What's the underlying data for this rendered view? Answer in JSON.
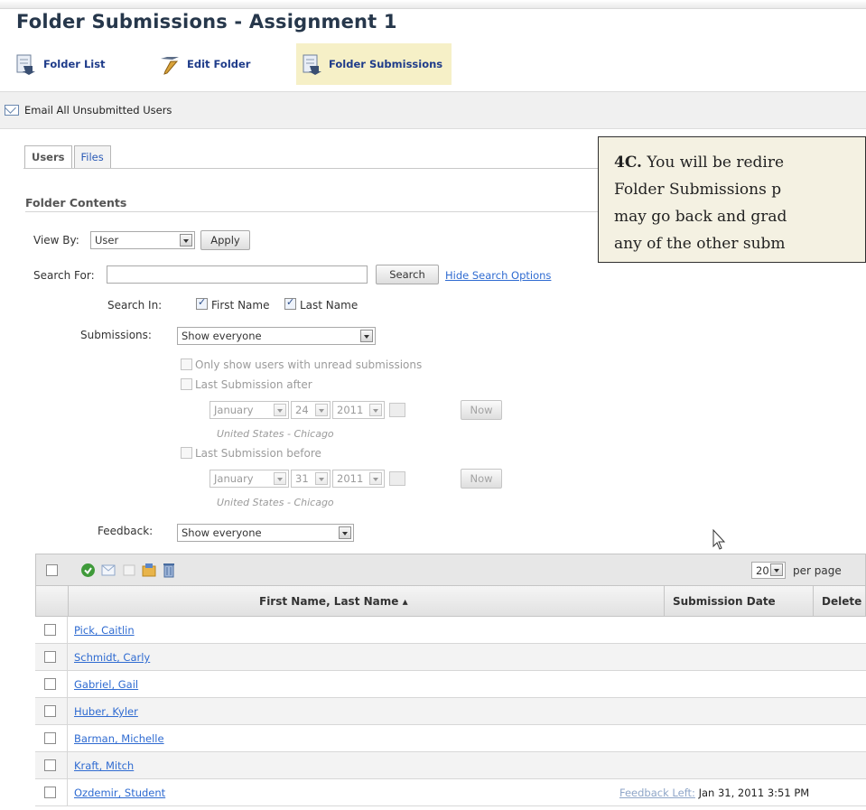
{
  "page": {
    "title": "Folder Submissions - Assignment 1"
  },
  "nav": {
    "items": [
      {
        "label": "Folder List",
        "icon": "folder-list-icon"
      },
      {
        "label": "Edit Folder",
        "icon": "edit-folder-icon"
      },
      {
        "label": "Folder Submissions",
        "icon": "folder-submissions-icon"
      }
    ]
  },
  "toolbar": {
    "email_label": "Email All Unsubmitted Users"
  },
  "tabs": [
    {
      "label": "Users"
    },
    {
      "label": "Files"
    }
  ],
  "section": {
    "title": "Folder Contents"
  },
  "view_by": {
    "label": "View By:",
    "value": "User",
    "apply_label": "Apply"
  },
  "search": {
    "label": "Search For:",
    "value": "",
    "button_label": "Search",
    "hide_options_label": "Hide Search Options",
    "search_in_label": "Search In:",
    "first_name_label": "First Name",
    "last_name_label": "Last Name"
  },
  "submissions": {
    "label": "Submissions:",
    "value": "Show everyone",
    "unread_label": "Only show users with unread submissions",
    "after_label": "Last Submission after",
    "after_month": "January",
    "after_day": "24",
    "after_year": "2011",
    "before_label": "Last Submission before",
    "before_month": "January",
    "before_day": "31",
    "before_year": "2011",
    "now_label": "Now",
    "timezone": "United States - Chicago"
  },
  "feedback": {
    "label": "Feedback:",
    "value": "Show everyone"
  },
  "callout": {
    "step": "4C.",
    "line1": "You will be redire",
    "line2": "Folder Submissions p",
    "line3": "may go back and grad",
    "line4": "any of the other subm"
  },
  "grid": {
    "per_page_value": "20",
    "per_page_label": "per page",
    "columns": {
      "name": "First Name, Last Name ▴",
      "date": "Submission Date",
      "deleted": "Delete"
    },
    "rows": [
      {
        "name": "Pick, Caitlin"
      },
      {
        "name": "Schmidt, Carly"
      },
      {
        "name": "Gabriel, Gail"
      },
      {
        "name": "Huber, Kyler"
      },
      {
        "name": "Barman, Michelle"
      },
      {
        "name": "Kraft, Mitch"
      },
      {
        "name": "Ozdemir, Student",
        "feedback_link": "Feedback Left:",
        "date": "Jan 31, 2011 3:51 PM"
      }
    ]
  },
  "colors": {
    "title": "#26374b",
    "link": "#2f6bd1",
    "active_nav_bg": "#f6f0c7",
    "callout_bg": "#f4f1e2"
  }
}
